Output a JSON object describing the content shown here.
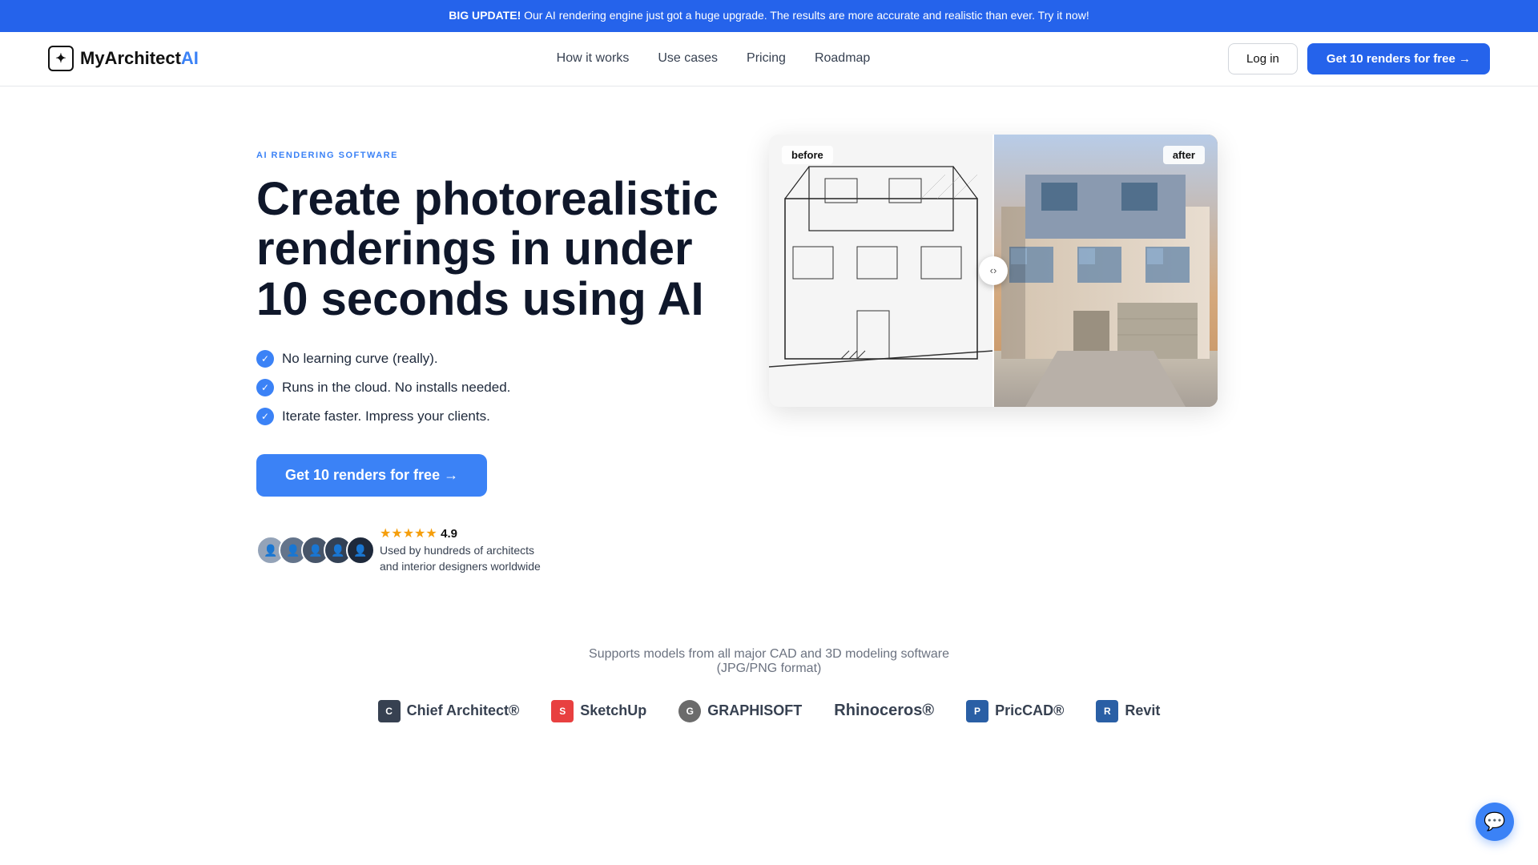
{
  "banner": {
    "prefix": "BIG UPDATE!",
    "text": " Our AI rendering engine just got a huge upgrade. The results are more accurate and realistic than ever. Try it now!"
  },
  "nav": {
    "logo_text": "MyArchitect",
    "logo_ai": "AI",
    "logo_symbol": "✦",
    "links": [
      {
        "label": "How it works",
        "href": "#"
      },
      {
        "label": "Use cases",
        "href": "#"
      },
      {
        "label": "Pricing",
        "href": "#"
      },
      {
        "label": "Roadmap",
        "href": "#"
      }
    ],
    "login_label": "Log in",
    "cta_label": "Get 10 renders for free →"
  },
  "hero": {
    "badge": "AI RENDERING SOFTWARE",
    "title": "Create photorealistic renderings in under 10 seconds using AI",
    "features": [
      "No learning curve (really).",
      "Runs in the cloud. No installs needed.",
      "Iterate faster. Impress your clients."
    ],
    "cta_label": "Get 10 renders for free →",
    "rating": "4.9",
    "proof_text": "Used by hundreds of architects and interior designers worldwide",
    "before_label": "before",
    "after_label": "after"
  },
  "bottom": {
    "support_text": "Supports models from all major CAD and 3D modeling software\n(JPG/PNG format)",
    "logos": [
      {
        "name": "Chief Architect®",
        "icon": "C"
      },
      {
        "name": "SketchUp",
        "icon": "S"
      },
      {
        "name": "GRAPHISOFT",
        "icon": "G"
      },
      {
        "name": "Rhinoceros®",
        "icon": "R"
      },
      {
        "name": "PricCAD®",
        "icon": "P"
      },
      {
        "name": "Revit",
        "icon": "R"
      }
    ]
  },
  "chat": {
    "icon": "💬"
  }
}
